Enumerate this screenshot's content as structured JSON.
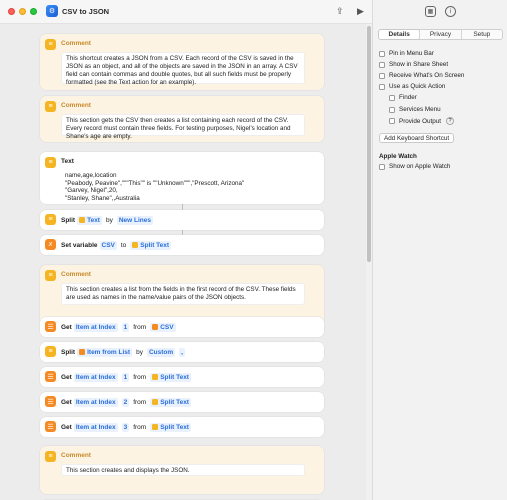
{
  "window": {
    "title": "CSV to JSON"
  },
  "sidebar": {
    "tabs": [
      "Details",
      "Privacy",
      "Setup"
    ],
    "options": [
      {
        "label": "Pin in Menu Bar",
        "indent": false
      },
      {
        "label": "Show in Share Sheet",
        "indent": false
      },
      {
        "label": "Receive What's On Screen",
        "indent": false
      },
      {
        "label": "Use as Quick Action",
        "indent": false
      },
      {
        "label": "Finder",
        "indent": true
      },
      {
        "label": "Services Menu",
        "indent": true
      },
      {
        "label": "Provide Output",
        "indent": true
      }
    ],
    "help_glyph": "?",
    "keyboard_button": "Add Keyboard Shortcut",
    "watch_heading": "Apple Watch",
    "watch_option": "Show on Apple Watch"
  },
  "actions": {
    "comment1": {
      "label": "Comment",
      "text": "This shortcut creates a JSON from a CSV. Each record of the CSV is saved in the JSON as an object, and all of the objects are saved in the JSON in an array.  A CSV field can contain commas and double quotes, but all such fields must be properly formatted (see the Text action for an example)."
    },
    "comment2": {
      "label": "Comment",
      "text": "This section gets the CSV then creates a list containing each record of the CSV. Every record must contain three fields. For testing purposes, Nigel's location and Shane's age are empty."
    },
    "text": {
      "label": "Text",
      "lines": [
        "name,age,location",
        "\"Peabody, Peavine\",\"\"\"This\"\" is \"\"Unknown\"\"\",\"Prescott, Arizona\"",
        "\"Garvey, Nigel\",20,",
        "\"Stanley, Shane\",,Australia"
      ]
    },
    "split1": {
      "verb": "Split",
      "input": "Text",
      "by": "by",
      "mode": "New Lines"
    },
    "setvar": {
      "verb": "Set variable",
      "var": "CSV",
      "to": "to",
      "value": "Split Text"
    },
    "comment3": {
      "label": "Comment",
      "text": "This section creates a list from the fields in the first record of the CSV. These fields are used as names in the name/value pairs of the JSON objects."
    },
    "get1": {
      "verb": "Get",
      "item": "Item at Index",
      "index": "1",
      "from": "from",
      "source": "CSV"
    },
    "split2": {
      "verb": "Split",
      "input": "Item from List",
      "by": "by",
      "mode": "Custom",
      "custom": ","
    },
    "get2": {
      "verb": "Get",
      "item": "Item at Index",
      "index": "1",
      "from": "from",
      "source": "Split Text"
    },
    "get3": {
      "verb": "Get",
      "item": "Item at Index",
      "index": "2",
      "from": "from",
      "source": "Split Text"
    },
    "get4": {
      "verb": "Get",
      "item": "Item at Index",
      "index": "3",
      "from": "from",
      "source": "Split Text"
    },
    "comment4": {
      "label": "Comment",
      "text": "This section creates and displays the JSON."
    }
  }
}
